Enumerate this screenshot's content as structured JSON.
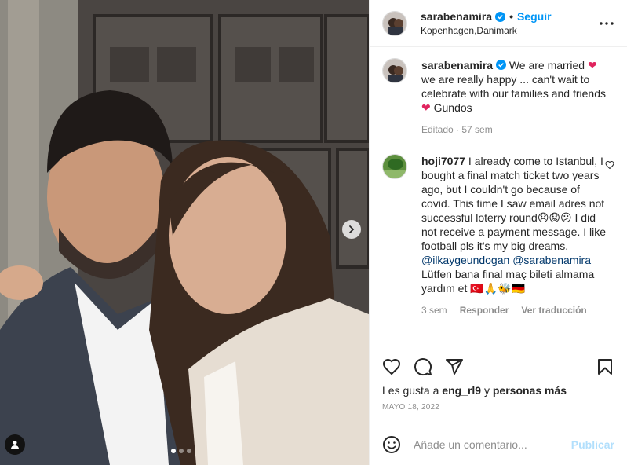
{
  "post": {
    "username": "sarabenamira",
    "follow_label": "Seguir",
    "separator": "•",
    "location": "Kopenhagen,Danimark"
  },
  "caption": {
    "username": "sarabenamira",
    "text_1": "We are married ",
    "text_2": " we are really happy ... can't wait to celebrate with our families and friends ",
    "text_3": " Gundos",
    "heart": "❤",
    "edited": "Editado · 57 sem"
  },
  "comment": {
    "username": "hoji7077",
    "text_1": "I already come to Istanbul, I bought a final match ticket two years ago, but I couldn't go because of covid. This time I saw email adres not successful loterry round😞😟😕 I did not receive a payment message. I like football pls it's my big dreams. ",
    "mention_1": "@ilkaygeundogan",
    "mention_2": "@sarabenamira",
    "text_2": " Lütfen bana final maç bileti almama yardım et 🇹🇷🙏🐝🇩🇪",
    "age": "3 sem",
    "reply": "Responder",
    "translate": "Ver traducción"
  },
  "likes": {
    "prefix": "Les gusta a ",
    "user": "eng_rl9",
    "suffix": " y ",
    "others": "personas más"
  },
  "date": "MAYO 18, 2022",
  "add_comment": {
    "placeholder": "Añade un comentario...",
    "publish_label": "Publicar"
  },
  "colors": {
    "accent": "#0095f6",
    "heart": "#e0245e",
    "publish_disabled": "#b2dffc"
  },
  "icons": [
    "more-icon",
    "verified-icon",
    "heart-icon",
    "comment-icon",
    "share-icon",
    "bookmark-icon",
    "emoji-icon",
    "chevron-right-icon",
    "user-tag-icon"
  ]
}
